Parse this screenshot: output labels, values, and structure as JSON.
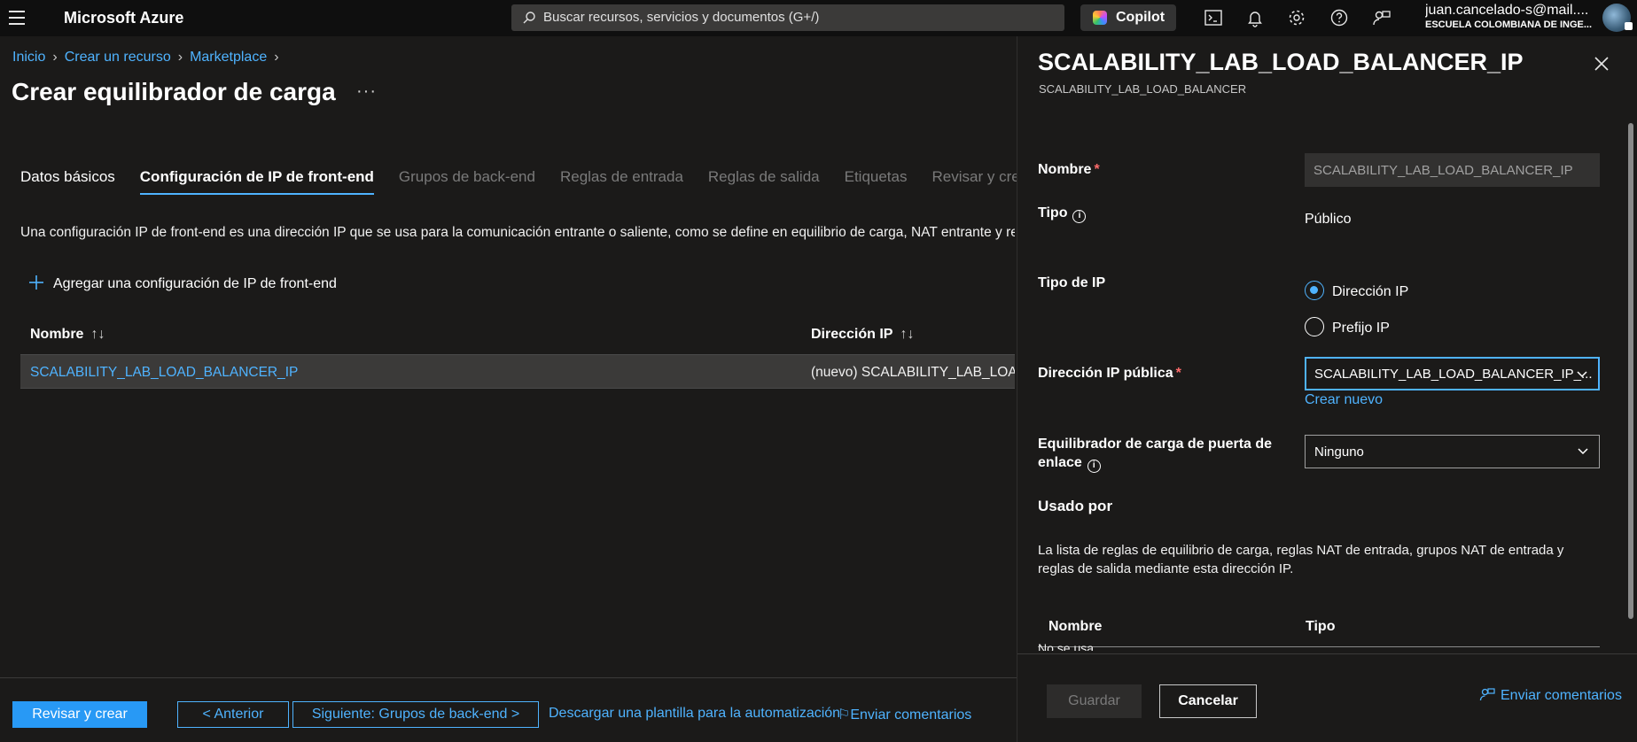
{
  "topbar": {
    "brand": "Microsoft Azure",
    "search_placeholder": "Buscar recursos, servicios y documentos (G+/)",
    "copilot_label": "Copilot",
    "icons": [
      "cloud-shell-icon",
      "bell-icon",
      "gear-icon",
      "help-icon",
      "feedback-icon"
    ],
    "user_email": "juan.cancelado-s@mail....",
    "user_org": "ESCUELA COLOMBIANA DE INGE..."
  },
  "breadcrumb": [
    "Inicio",
    "Crear un recurso",
    "Marketplace"
  ],
  "page_title": "Crear equilibrador de carga",
  "more_label": "···",
  "tabs": [
    {
      "label": "Datos básicos",
      "state": "done"
    },
    {
      "label": "Configuración de IP de front-end",
      "state": "active"
    },
    {
      "label": "Grupos de back-end",
      "state": "pending"
    },
    {
      "label": "Reglas de entrada",
      "state": "pending"
    },
    {
      "label": "Reglas de salida",
      "state": "pending"
    },
    {
      "label": "Etiquetas",
      "state": "pending"
    },
    {
      "label": "Revisar y crear",
      "state": "pending"
    }
  ],
  "description": "Una configuración IP de front-end es una dirección IP que se usa para la comunicación entrante o saliente, como se define en equilibrio de carga, NAT entrante y re",
  "add_label": "Agregar una configuración de IP de front-end",
  "grid": {
    "columns": [
      "Nombre",
      "Dirección IP"
    ],
    "sort_glyph": "↑↓",
    "rows": [
      {
        "name": "SCALABILITY_LAB_LOAD_BALANCER_IP",
        "ip": "(nuevo) SCALABILITY_LAB_LOAD_I"
      }
    ]
  },
  "bottombar": {
    "review_create": "Revisar y crear",
    "previous": "< Anterior",
    "next": "Siguiente: Grupos de back-end >",
    "download_template": "Descargar una plantilla para la automatización",
    "feedback": "Enviar comentarios"
  },
  "panel": {
    "title": "SCALABILITY_LAB_LOAD_BALANCER_IP",
    "subtitle": "SCALABILITY_LAB_LOAD_BALANCER",
    "name_label": "Nombre",
    "name_value": "SCALABILITY_LAB_LOAD_BALANCER_IP",
    "type_label": "Tipo",
    "type_value": "Público",
    "ip_type_label": "Tipo de IP",
    "ip_type_options": [
      {
        "label": "Dirección IP",
        "selected": true
      },
      {
        "label": "Prefijo IP",
        "selected": false
      }
    ],
    "public_ip_label": "Dirección IP pública",
    "public_ip_value": "SCALABILITY_LAB_LOAD_BALANCER_IP_...",
    "create_new": "Crear nuevo",
    "gateway_label_1": "Equilibrador de carga de puerta de",
    "gateway_label_2": "enlace",
    "gateway_value": "Ninguno",
    "used_by_title": "Usado por",
    "used_by_desc": "La lista de reglas de equilibrio de carga, reglas NAT de entrada, grupos NAT de entrada y reglas de salida mediante esta dirección IP.",
    "used_columns": [
      "Nombre",
      "Tipo"
    ],
    "not_used": "No se usa",
    "save": "Guardar",
    "cancel": "Cancelar",
    "feedback": "Enviar comentarios",
    "required_mark": "*",
    "info_glyph": "i"
  },
  "colors": {
    "accent": "#4fb3ff",
    "primary_button": "#2899f5",
    "background": "#1b1a19",
    "topbar": "#0f0f0f"
  }
}
